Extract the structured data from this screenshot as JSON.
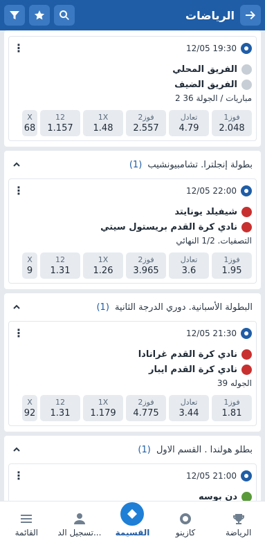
{
  "header": {
    "title": "الرياضات"
  },
  "groups": [
    {
      "title": "",
      "count": "",
      "matches": [
        {
          "time": "12/05 19:30",
          "teams": [
            "الفريق المحلي",
            "الفريق الضيف"
          ],
          "meta": "2 مباريات / الجولة 36",
          "odds": [
            {
              "label": "فوز1",
              "value": "2.048"
            },
            {
              "label": "تعادل",
              "value": "4.79"
            },
            {
              "label": "فوز2",
              "value": "2.557"
            },
            {
              "label": "1X",
              "value": "1.48"
            },
            {
              "label": "12",
              "value": "1.157"
            },
            {
              "label": "X",
              "value": "68"
            }
          ]
        }
      ]
    },
    {
      "title": "بطولة إنجلترا. تشامبيونشيب",
      "count": "(1)",
      "matches": [
        {
          "time": "12/05 22:00",
          "teams": [
            "شيفيلد يونايتد",
            "نادي كرة القدم بريستول سيتي"
          ],
          "meta": "التصفيات. 1/2 النهائي",
          "odds": [
            {
              "label": "فوز1",
              "value": "1.95"
            },
            {
              "label": "تعادل",
              "value": "3.6"
            },
            {
              "label": "فوز2",
              "value": "3.965"
            },
            {
              "label": "1X",
              "value": "1.26"
            },
            {
              "label": "12",
              "value": "1.31"
            },
            {
              "label": "X",
              "value": "9"
            }
          ]
        }
      ]
    },
    {
      "title": "البطولة الأسبانية. دوري الدرجة الثانية",
      "count": "(1)",
      "matches": [
        {
          "time": "12/05 21:30",
          "teams": [
            "نادي كرة القدم غرانادا",
            "نادي كرة القدم ايبار"
          ],
          "meta": "الجوله 39",
          "odds": [
            {
              "label": "فوز1",
              "value": "1.81"
            },
            {
              "label": "تعادل",
              "value": "3.44"
            },
            {
              "label": "فوز2",
              "value": "4.775"
            },
            {
              "label": "1X",
              "value": "1.179"
            },
            {
              "label": "12",
              "value": "1.31"
            },
            {
              "label": "X",
              "value": "92"
            }
          ]
        }
      ]
    },
    {
      "title": "بطلو هولندا . القسم الاول",
      "count": "(1)",
      "matches": [
        {
          "time": "12/05 21:00",
          "teams": [
            "دن بوسه"
          ],
          "meta": "",
          "odds": []
        }
      ]
    }
  ],
  "bottom_nav": [
    {
      "label": "الرياضة",
      "icon": "trophy-icon"
    },
    {
      "label": "كازينو",
      "icon": "casino-chip-icon"
    },
    {
      "label": "القسيمة",
      "icon": "coupon-icon"
    },
    {
      "label": "تسجيل الد...",
      "icon": "user-icon"
    },
    {
      "label": "القائمة",
      "icon": "menu-icon"
    }
  ],
  "colors": {
    "primary": "#1f5da6",
    "accent": "#1f7fd6",
    "background": "#e6eaef"
  }
}
